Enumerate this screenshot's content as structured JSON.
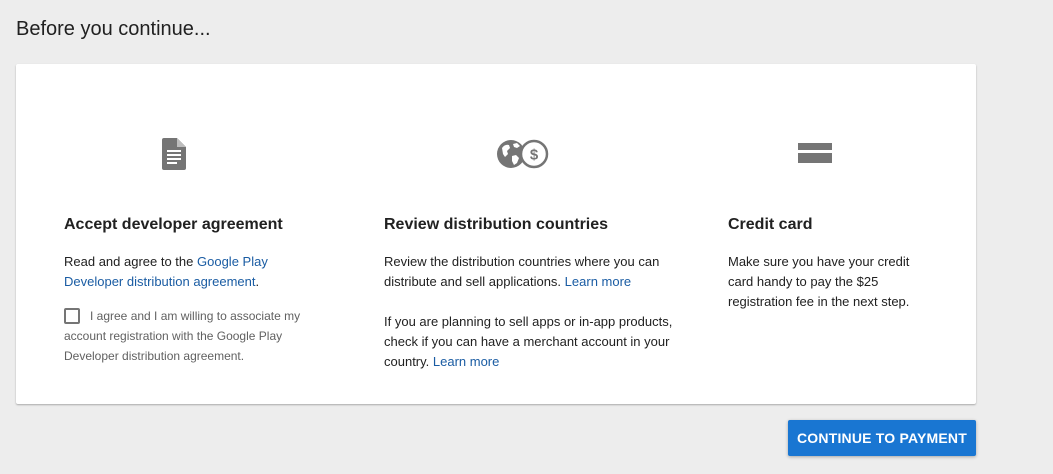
{
  "page": {
    "title": "Before you continue..."
  },
  "colors": {
    "accent": "#1976d2",
    "link": "#1a5ca3",
    "icon": "#757575",
    "background": "#ededed"
  },
  "sections": {
    "agreement": {
      "icon": "document-icon",
      "title": "Accept developer agreement",
      "text_prefix": "Read and agree to the ",
      "link": "Google Play Developer distribution agreement",
      "text_suffix": ".",
      "checkbox_label": "I agree and I am willing to associate my account registration with the Google Play Developer distribution agreement.",
      "checked": false
    },
    "countries": {
      "icon": "globe-dollar-icon",
      "title": "Review distribution countries",
      "text1": "Review the distribution countries where you can distribute and sell applications. ",
      "link1": "Learn more",
      "text2": "If you are planning to sell apps or in-app products, check if you can have a merchant account in your country. ",
      "link2": "Learn more"
    },
    "credit_card": {
      "icon": "credit-card-icon",
      "title": "Credit card",
      "text": "Make sure you have your credit card handy to pay the $25 registration fee in the next step."
    }
  },
  "actions": {
    "continue_label": "CONTINUE TO PAYMENT"
  }
}
